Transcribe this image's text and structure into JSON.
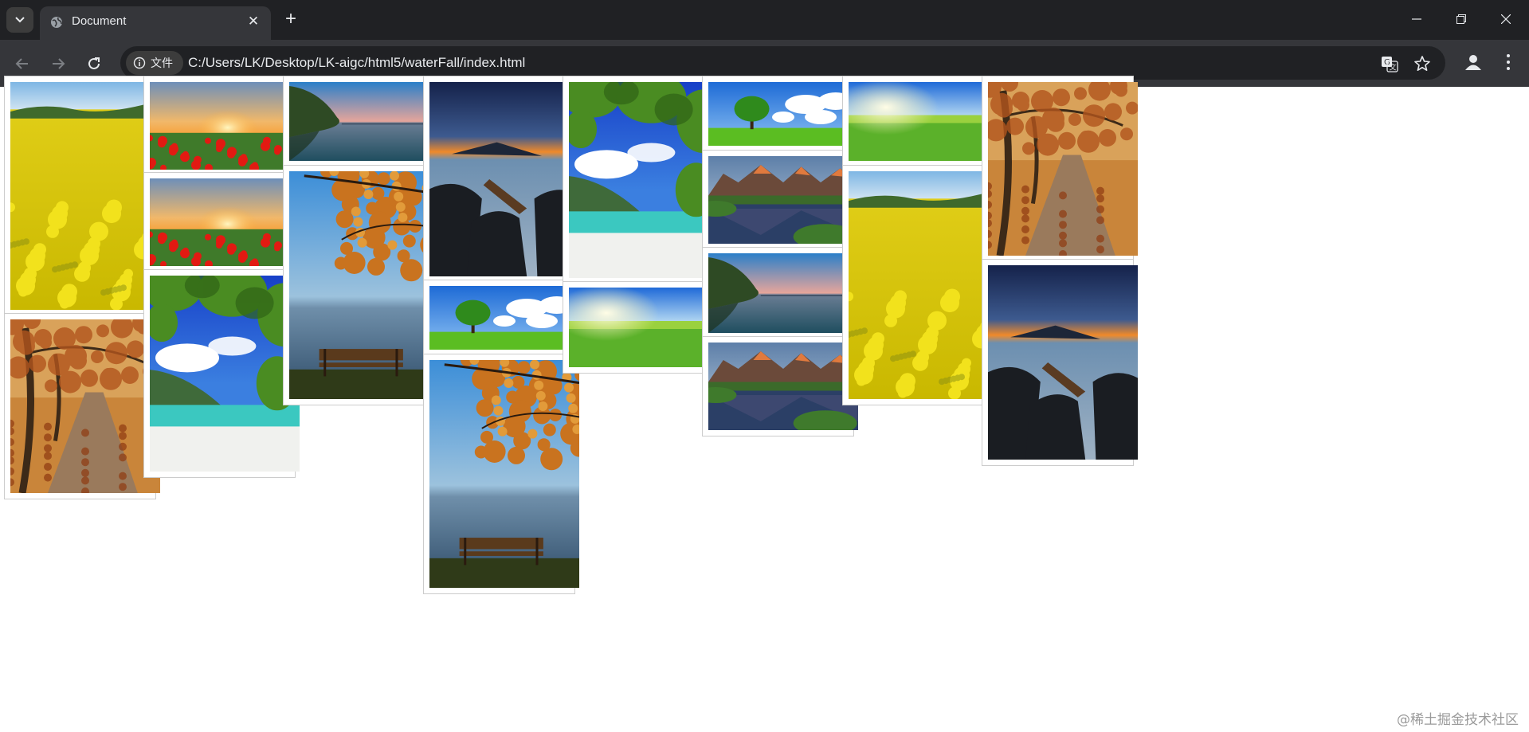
{
  "browser": {
    "tab_title": "Document",
    "new_tab_label": "+",
    "chip_label": "文件",
    "url": "C:/Users/LK/Desktop/LK-aigc/html5/waterFall/index.html"
  },
  "gallery": {
    "images": [
      {
        "subject": "rapeseed-field"
      },
      {
        "subject": "autumn-path"
      },
      {
        "subject": "poppy-sunset"
      },
      {
        "subject": "poppy-sunset"
      },
      {
        "subject": "tropical-beach-leaves"
      },
      {
        "subject": "lake-cliff"
      },
      {
        "subject": "autumn-bench-lake"
      },
      {
        "subject": "mountain-sunset-rocks"
      },
      {
        "subject": "tree-on-meadow"
      },
      {
        "subject": "autumn-bench-lake"
      },
      {
        "subject": "tropical-beach-leaves"
      },
      {
        "subject": "green-field-sun"
      },
      {
        "subject": "tree-on-meadow"
      },
      {
        "subject": "mountain-lake-reflection"
      },
      {
        "subject": "lake-cliff"
      },
      {
        "subject": "mountain-lake-reflection"
      },
      {
        "subject": "green-field-sun"
      },
      {
        "subject": "rapeseed-field"
      },
      {
        "subject": "autumn-path"
      },
      {
        "subject": "mountain-sunset-rocks"
      }
    ]
  },
  "watermark": "@稀土掘金技术社区",
  "colors": {
    "tabbar_bg": "#202124",
    "toolbar_bg": "#35363a",
    "card_border": "#cccccc"
  }
}
